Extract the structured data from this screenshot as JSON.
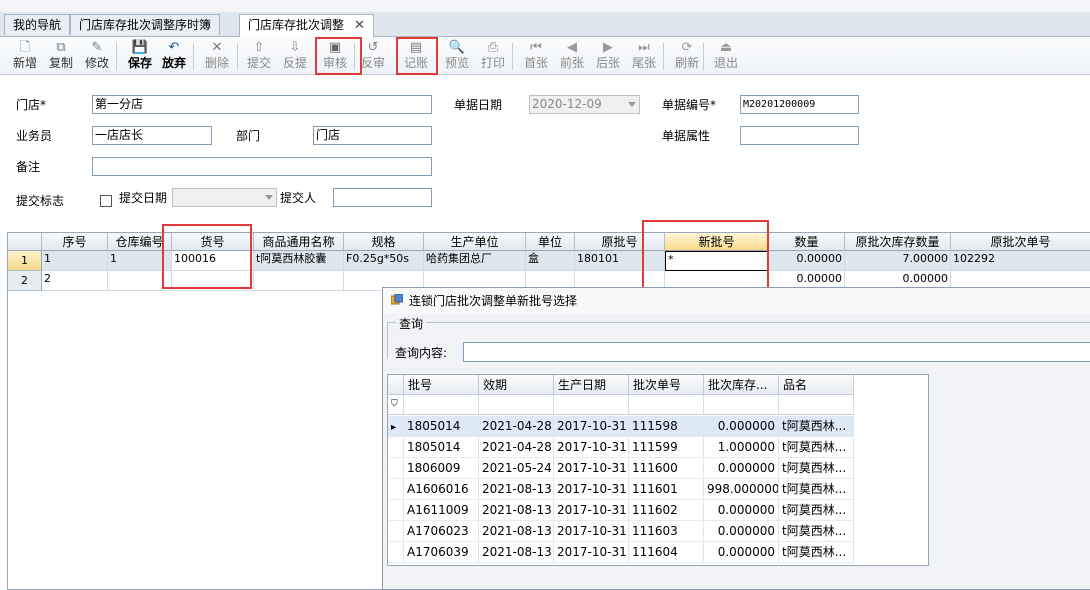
{
  "tabs": [
    {
      "label": "我的导航"
    },
    {
      "label": "门店库存批次调整序时簿"
    },
    {
      "label": "门店库存批次调整",
      "active": true
    }
  ],
  "toolbar": {
    "buttons": [
      {
        "label": "新增",
        "icon": "new-doc-icon"
      },
      {
        "label": "复制",
        "icon": "copy-icon"
      },
      {
        "label": "修改",
        "icon": "edit-icon"
      },
      {
        "label": "保存",
        "icon": "save-icon"
      },
      {
        "label": "放弃",
        "icon": "undo-icon"
      },
      {
        "label": "删除",
        "icon": "delete-icon"
      },
      {
        "label": "提交",
        "icon": "submit-icon"
      },
      {
        "label": "反提",
        "icon": "unsubmit-icon"
      },
      {
        "label": "审核",
        "icon": "audit-icon"
      },
      {
        "label": "反审",
        "icon": "unaudit-icon"
      },
      {
        "label": "记账",
        "icon": "post-icon"
      },
      {
        "label": "预览",
        "icon": "preview-icon"
      },
      {
        "label": "打印",
        "icon": "print-icon"
      },
      {
        "label": "首张",
        "icon": "first-icon"
      },
      {
        "label": "前张",
        "icon": "prev-icon"
      },
      {
        "label": "后张",
        "icon": "next-icon"
      },
      {
        "label": "尾张",
        "icon": "last-icon"
      },
      {
        "label": "刷新",
        "icon": "refresh-icon"
      },
      {
        "label": "退出",
        "icon": "exit-icon"
      }
    ]
  },
  "form": {
    "store_label": "门店*",
    "store_value": "第一分店",
    "date_label": "单据日期",
    "date_value": "2020-12-09",
    "doc_no_label": "单据编号*",
    "doc_no_value": "M20201200009",
    "salesman_label": "业务员",
    "salesman_value": "一店店长",
    "dept_label": "部门",
    "dept_value": "门店",
    "doc_attr_label": "单据属性",
    "doc_attr_value": "",
    "remark_label": "备注",
    "remark_value": "",
    "submit_flag_label": "提交标志",
    "submit_date_label": "提交日期",
    "submit_date_value": "",
    "submitter_label": "提交人",
    "submitter_value": ""
  },
  "grid": {
    "columns": [
      "序号",
      "仓库编号",
      "货号",
      "商品通用名称",
      "规格",
      "生产单位",
      "单位",
      "原批号",
      "新批号",
      "数量",
      "原批次库存数量",
      "原批次单号"
    ],
    "rows": [
      {
        "rownum": "1",
        "cells": [
          "1",
          "1",
          "100016",
          "t阿莫西林胶囊",
          "F0.25g*50s",
          "哈药集团总厂",
          "盒",
          "180101",
          "*",
          "0.00000",
          "7.00000",
          "102292"
        ]
      },
      {
        "rownum": "2",
        "cells": [
          "2",
          "",
          "",
          "",
          "",
          "",
          "",
          "",
          "",
          "0.00000",
          "0.00000",
          ""
        ]
      }
    ]
  },
  "popup": {
    "title": "连锁门店批次调整单新批号选择",
    "group_label": "查询",
    "query_label": "查询内容:",
    "query_value": "",
    "columns": [
      "批号",
      "效期",
      "生产日期",
      "批次单号",
      "批次库存...",
      "品名"
    ],
    "rows": [
      [
        "1805014",
        "2021-04-28",
        "2017-10-31",
        "111598",
        "0.000000",
        "t阿莫西林..."
      ],
      [
        "1805014",
        "2021-04-28",
        "2017-10-31",
        "111599",
        "1.000000",
        "t阿莫西林..."
      ],
      [
        "1806009",
        "2021-05-24",
        "2017-10-31",
        "111600",
        "0.000000",
        "t阿莫西林..."
      ],
      [
        "A1606016",
        "2021-08-13",
        "2017-10-31",
        "111601",
        "998.000000",
        "t阿莫西林..."
      ],
      [
        "A1611009",
        "2021-08-13",
        "2017-10-31",
        "111602",
        "0.000000",
        "t阿莫西林..."
      ],
      [
        "A1706023",
        "2021-08-13",
        "2017-10-31",
        "111603",
        "0.000000",
        "t阿莫西林..."
      ],
      [
        "A1706039",
        "2021-08-13",
        "2017-10-31",
        "111604",
        "0.000000",
        "t阿莫西林..."
      ]
    ]
  },
  "colors": {
    "highlight_red": "#e03a3a",
    "selected_row": "#dde9f7",
    "header_active": "#f6d98a"
  }
}
